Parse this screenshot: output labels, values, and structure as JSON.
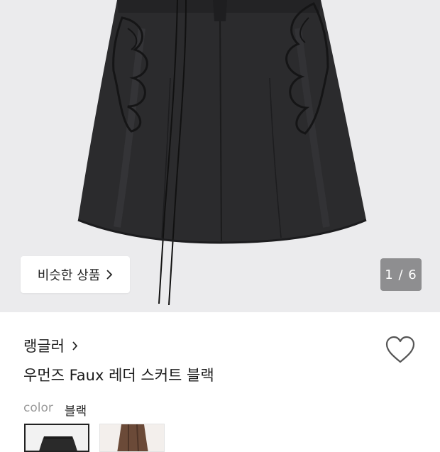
{
  "gallery": {
    "similar_label": "비슷한 상품",
    "counter": "1 / 6"
  },
  "product": {
    "brand": "랭글러",
    "title": "우먼즈 Faux 레더 스커트 블랙",
    "color_label": "color",
    "color_value": "블랙"
  },
  "swatches": [
    {
      "name": "블랙",
      "selected": true,
      "color": "#2a2a2a"
    },
    {
      "name": "브라운",
      "selected": false,
      "color": "#6b4a38"
    }
  ],
  "icons": {
    "chevron": "chevron-right-icon",
    "wishlist": "heart-outline-icon"
  }
}
